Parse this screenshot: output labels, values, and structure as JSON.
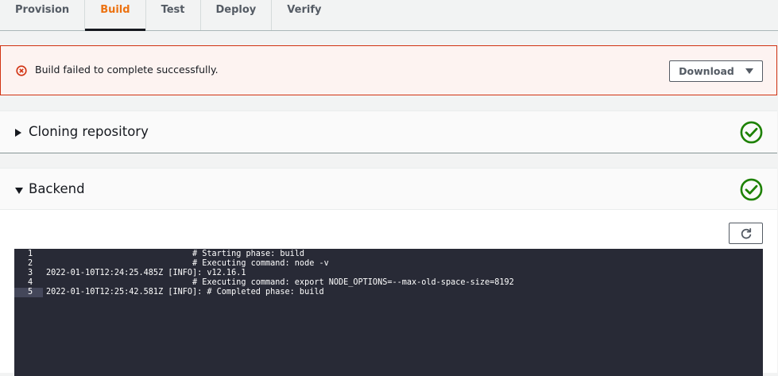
{
  "tabs": [
    {
      "label": "Provision",
      "active": false
    },
    {
      "label": "Build",
      "active": true
    },
    {
      "label": "Test",
      "active": false
    },
    {
      "label": "Deploy",
      "active": false
    },
    {
      "label": "Verify",
      "active": false
    }
  ],
  "alert": {
    "icon": "error-circle-icon",
    "message": "Build failed to complete successfully.",
    "download_label": "Download"
  },
  "sections": {
    "cloning": {
      "title": "Cloning repository",
      "expanded": false,
      "status": "success"
    },
    "backend": {
      "title": "Backend",
      "expanded": true,
      "status": "success"
    }
  },
  "log": {
    "lines": [
      {
        "num": "1",
        "text": "                              # Starting phase: build"
      },
      {
        "num": "2",
        "text": "                              # Executing command: node -v"
      },
      {
        "num": "3",
        "text": "2022-01-10T12:24:25.485Z [INFO]: v12.16.1"
      },
      {
        "num": "4",
        "text": "                              # Executing command: export NODE_OPTIONS=--max-old-space-size=8192"
      },
      {
        "num": "5",
        "text": "2022-01-10T12:25:42.581Z [INFO]: # Completed phase: build"
      }
    ],
    "highlighted_line": 5
  },
  "colors": {
    "accent": "#ec7211",
    "error": "#d13212",
    "success": "#1d8102",
    "terminal_bg": "#282a36"
  }
}
